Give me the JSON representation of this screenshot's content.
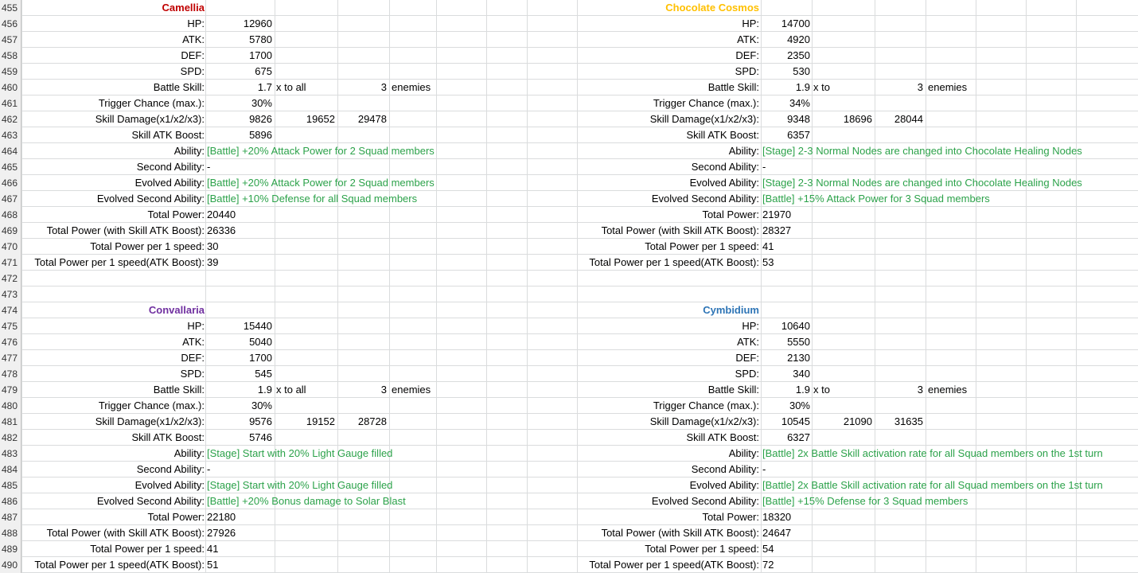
{
  "colors": {
    "camellia": "#c00000",
    "chocolate_cosmos": "#ffc000",
    "convallaria": "#7030a0",
    "cymbidium": "#2e75b6",
    "ability_green": "#2ca24a"
  },
  "row_numbers": [
    "455",
    "456",
    "457",
    "458",
    "459",
    "460",
    "461",
    "462",
    "463",
    "464",
    "465",
    "466",
    "467",
    "468",
    "469",
    "470",
    "471",
    "472",
    "473",
    "474",
    "475",
    "476",
    "477",
    "478",
    "479",
    "480",
    "481",
    "482",
    "483",
    "484",
    "485",
    "486",
    "487",
    "488",
    "489",
    "490"
  ],
  "labels": {
    "hp": "HP:",
    "atk": "ATK:",
    "def": "DEF:",
    "spd": "SPD:",
    "battle_skill": "Battle Skill:",
    "trigger": "Trigger Chance (max.):",
    "skill_damage": "Skill Damage(x1/x2/x3):",
    "skill_atk_boost": "Skill ATK Boost:",
    "ability": "Ability:",
    "second_ability": "Second Ability:",
    "evolved_ability": "Evolved Ability:",
    "evolved_second_ability": "Evolved Second Ability:",
    "total_power": "Total Power:",
    "total_power_boost": "Total Power (with Skill ATK Boost):",
    "tp_per_speed": "Total Power per 1 speed:",
    "tp_per_speed_boost": "Total Power per 1 speed(ATK Boost):"
  },
  "characters": [
    {
      "name": "Camellia",
      "hp": "12960",
      "atk": "5780",
      "def": "1700",
      "spd": "675",
      "skill_mult": "1.7",
      "skill_target": "x to all",
      "skill_count": "3",
      "skill_unit": "enemies",
      "trigger": "30%",
      "dmg1": "9826",
      "dmg2": "19652",
      "dmg3": "29478",
      "skill_atk_boost": "5896",
      "ability": "[Battle] +20% Attack Power for 2 Squad members",
      "second_ability": "-",
      "evolved_ability": "[Battle] +20% Attack Power for 2 Squad members",
      "evolved_second_ability": "[Battle] +10% Defense for all Squad members",
      "total_power": "20440",
      "total_power_boost": "26336",
      "tp_per_speed": "30",
      "tp_per_speed_boost": "39"
    },
    {
      "name": "Chocolate Cosmos",
      "hp": "14700",
      "atk": "4920",
      "def": "2350",
      "spd": "530",
      "skill_mult": "1.9",
      "skill_target": "x to",
      "skill_count": "3",
      "skill_unit": "enemies",
      "trigger": "34%",
      "dmg1": "9348",
      "dmg2": "18696",
      "dmg3": "28044",
      "skill_atk_boost": "6357",
      "ability": "[Stage] 2-3 Normal Nodes are changed into Chocolate Healing Nodes",
      "second_ability": "-",
      "evolved_ability": "[Stage] 2-3 Normal Nodes are changed into Chocolate Healing Nodes",
      "evolved_second_ability": "[Battle] +15% Attack Power for 3 Squad members",
      "total_power": "21970",
      "total_power_boost": "28327",
      "tp_per_speed": "41",
      "tp_per_speed_boost": "53"
    },
    {
      "name": "Convallaria",
      "hp": "15440",
      "atk": "5040",
      "def": "1700",
      "spd": "545",
      "skill_mult": "1.9",
      "skill_target": "x to all",
      "skill_count": "3",
      "skill_unit": "enemies",
      "trigger": "30%",
      "dmg1": "9576",
      "dmg2": "19152",
      "dmg3": "28728",
      "skill_atk_boost": "5746",
      "ability": "[Stage] Start with 20% Light Gauge filled",
      "second_ability": "-",
      "evolved_ability": "[Stage] Start with 20% Light Gauge filled",
      "evolved_second_ability": "[Battle] +20% Bonus damage to Solar Blast",
      "total_power": "22180",
      "total_power_boost": "27926",
      "tp_per_speed": "41",
      "tp_per_speed_boost": "51"
    },
    {
      "name": "Cymbidium",
      "hp": "10640",
      "atk": "5550",
      "def": "2130",
      "spd": "340",
      "skill_mult": "1.9",
      "skill_target": "x to",
      "skill_count": "3",
      "skill_unit": "enemies",
      "trigger": "30%",
      "dmg1": "10545",
      "dmg2": "21090",
      "dmg3": "31635",
      "skill_atk_boost": "6327",
      "ability": "[Battle] 2x Battle Skill activation rate for all Squad members on the 1st turn",
      "second_ability": "-",
      "evolved_ability": "[Battle] 2x Battle Skill activation rate for all Squad members on the 1st turn",
      "evolved_second_ability": "[Battle] +15% Defense for 3 Squad members",
      "total_power": "18320",
      "total_power_boost": "24647",
      "tp_per_speed": "54",
      "tp_per_speed_boost": "72"
    }
  ]
}
